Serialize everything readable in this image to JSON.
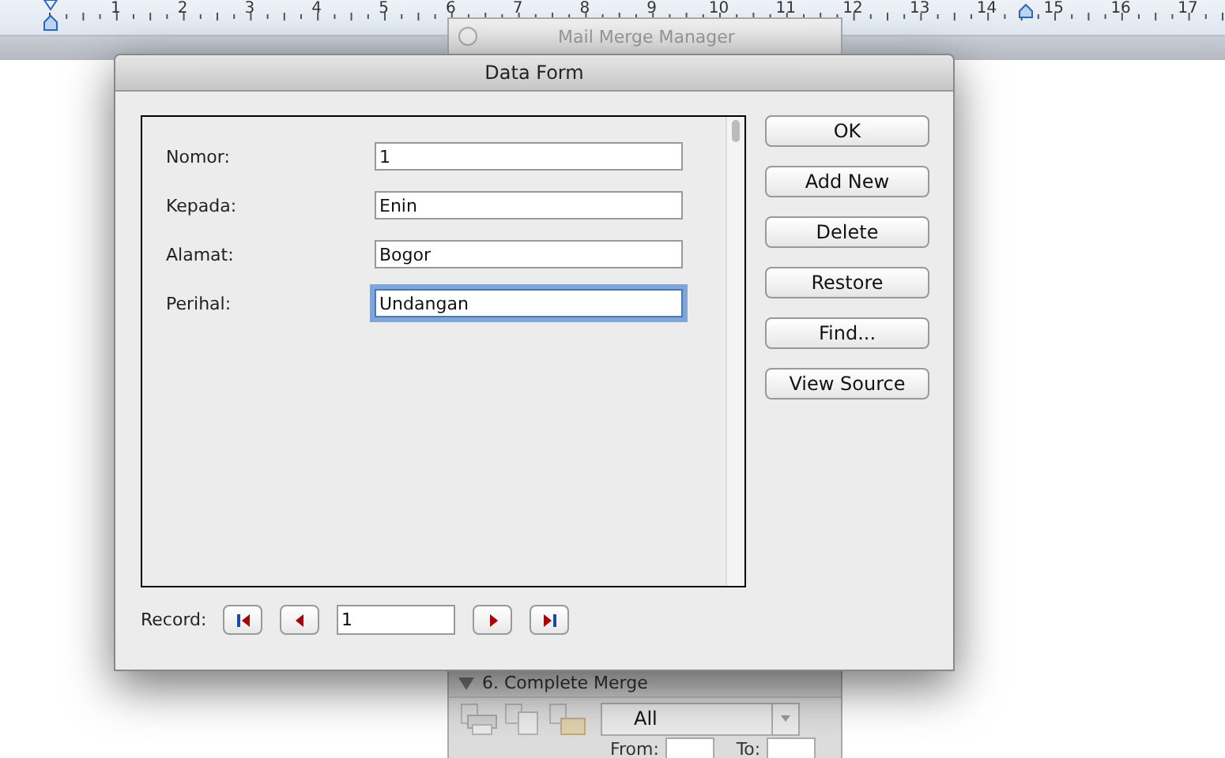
{
  "ruler": {
    "numbers": [
      "1",
      "2",
      "3",
      "4",
      "5",
      "6",
      "7",
      "8",
      "9",
      "10",
      "11",
      "12",
      "13",
      "14",
      "15",
      "16",
      "17"
    ]
  },
  "mail_merge_manager": {
    "title": "Mail Merge Manager",
    "section": {
      "title": "6. Complete Merge",
      "expanded": true,
      "range": "All",
      "from_label": "From:",
      "to_label": "To:"
    }
  },
  "data_form": {
    "title": "Data Form",
    "fields": [
      {
        "label": "Nomor:",
        "value": "1",
        "focused": false
      },
      {
        "label": "Kepada:",
        "value": "Enin",
        "focused": false
      },
      {
        "label": "Alamat:",
        "value": "Bogor",
        "focused": false
      },
      {
        "label": "Perihal:",
        "value": "Undangan",
        "focused": true
      }
    ],
    "buttons": [
      "OK",
      "Add New",
      "Delete",
      "Restore",
      "Find...",
      "View Source"
    ],
    "record": {
      "label": "Record:",
      "value": "1"
    }
  }
}
